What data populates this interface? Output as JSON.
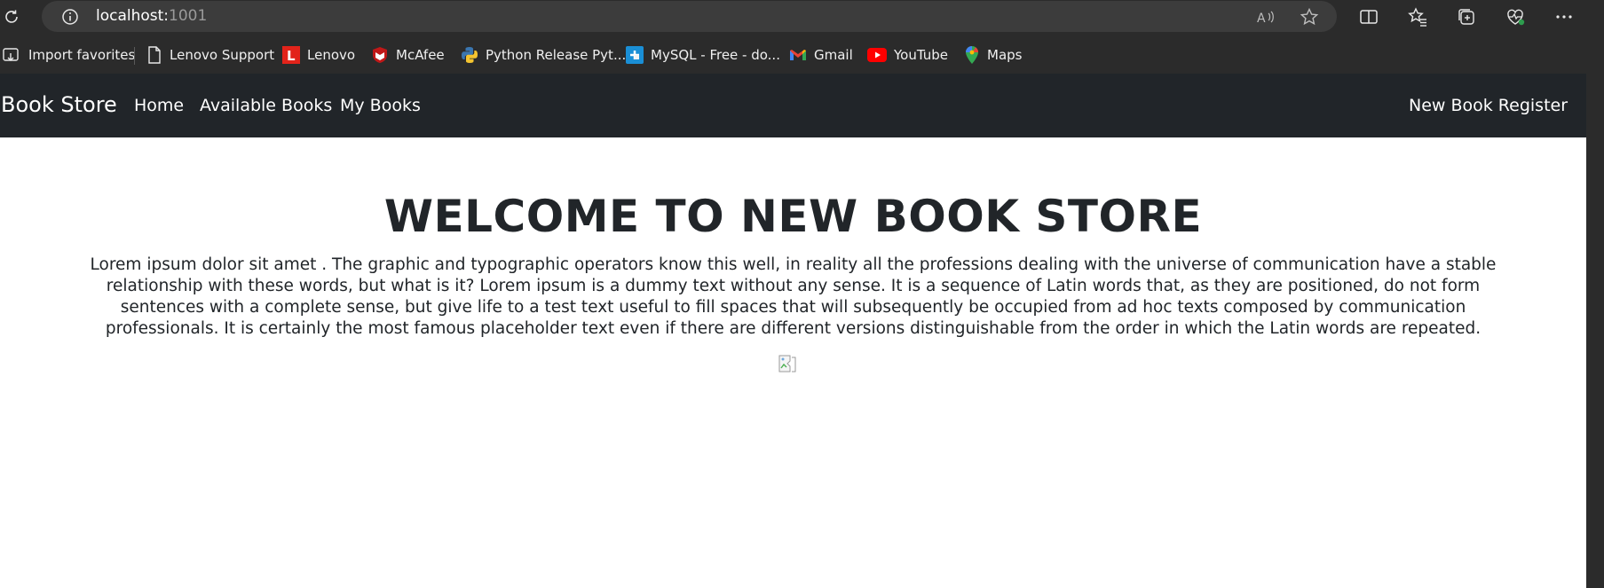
{
  "browser": {
    "url_host": "localhost:",
    "url_port": "1001",
    "favorites": [
      {
        "label": "Import favorites",
        "icon": "import-icon"
      },
      {
        "label": "Lenovo Support",
        "icon": "page-icon"
      },
      {
        "label": "Lenovo",
        "icon": "lenovo-icon"
      },
      {
        "label": "McAfee",
        "icon": "mcafee-icon"
      },
      {
        "label": "Python Release Pyt...",
        "icon": "python-icon"
      },
      {
        "label": "MySQL - Free - do...",
        "icon": "mysql-icon"
      },
      {
        "label": "Gmail",
        "icon": "gmail-icon"
      },
      {
        "label": "YouTube",
        "icon": "youtube-icon"
      },
      {
        "label": "Maps",
        "icon": "maps-icon"
      }
    ]
  },
  "navbar": {
    "brand": "Book Store",
    "links": [
      "Home",
      "Available Books",
      "My Books"
    ],
    "right_link": "New Book Register"
  },
  "hero": {
    "title": "WELCOME TO NEW BOOK STORE",
    "text": "Lorem ipsum dolor sit amet . The graphic and typographic operators know this well, in reality all the professions dealing with the universe of communication have a stable relationship with these words, but what is it? Lorem ipsum is a dummy text without any sense. It is a sequence of Latin words that, as they are positioned, do not form sentences with a complete sense, but give life to a test text useful to fill spaces that will subsequently be occupied from ad hoc texts composed by communication professionals. It is certainly the most famous placeholder text even if there are different versions distinguishable from the order in which the Latin words are repeated."
  },
  "colors": {
    "chrome_bg": "#2b2b2b",
    "address_bar_bg": "#3c3c3c",
    "navbar_bg": "#212529",
    "text_dark": "#212529"
  }
}
